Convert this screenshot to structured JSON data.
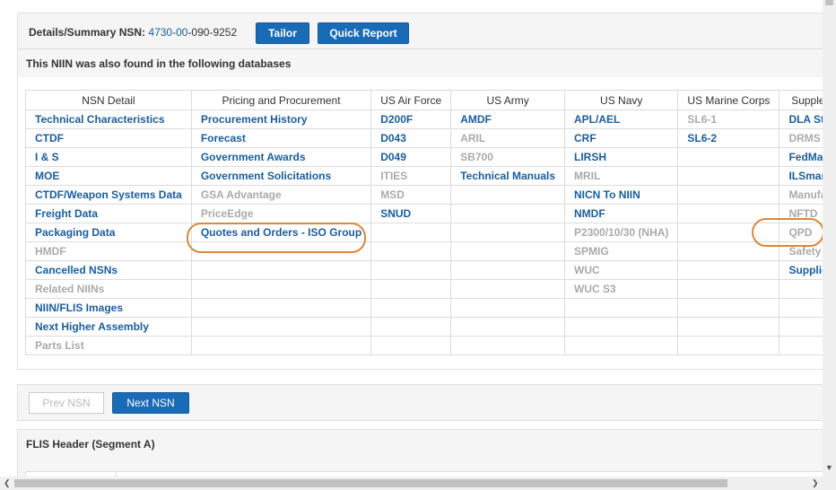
{
  "header": {
    "label": "Details/Summary NSN:",
    "nsn_link": "4730-00",
    "nsn_rest": "-090-9252",
    "tailor_label": "Tailor",
    "quick_report_label": "Quick Report"
  },
  "found_text": "This NIIN was also found in the following databases",
  "table": {
    "headers": [
      "NSN Detail",
      "Pricing and Procurement",
      "US Air Force",
      "US Army",
      "US Navy",
      "US Marine Corps",
      "Supplement"
    ],
    "rows": [
      [
        {
          "t": "Technical Characteristics",
          "s": "link"
        },
        {
          "t": "Procurement History",
          "s": "link"
        },
        {
          "t": "D200F",
          "s": "link"
        },
        {
          "t": "AMDF",
          "s": "link"
        },
        {
          "t": "APL/AEL",
          "s": "link"
        },
        {
          "t": "SL6-1",
          "s": "grey"
        },
        {
          "t": "DLA Stock",
          "s": "link"
        }
      ],
      [
        {
          "t": "CTDF",
          "s": "link"
        },
        {
          "t": "Forecast",
          "s": "link"
        },
        {
          "t": "D043",
          "s": "link"
        },
        {
          "t": "ARIL",
          "s": "grey"
        },
        {
          "t": "CRF",
          "s": "link"
        },
        {
          "t": "SL6-2",
          "s": "link"
        },
        {
          "t": "DRMS",
          "s": "grey"
        }
      ],
      [
        {
          "t": "I & S",
          "s": "link"
        },
        {
          "t": "Government Awards",
          "s": "link"
        },
        {
          "t": "D049",
          "s": "link"
        },
        {
          "t": "SB700",
          "s": "grey"
        },
        {
          "t": "LIRSH",
          "s": "link"
        },
        {
          "t": "",
          "s": ""
        },
        {
          "t": "FedMall",
          "s": "link"
        }
      ],
      [
        {
          "t": "MOE",
          "s": "link"
        },
        {
          "t": "Government Solicitations",
          "s": "link"
        },
        {
          "t": "ITIES",
          "s": "grey"
        },
        {
          "t": "Technical Manuals",
          "s": "link"
        },
        {
          "t": "MRIL",
          "s": "grey"
        },
        {
          "t": "",
          "s": ""
        },
        {
          "t": "ILSmart",
          "s": "link"
        }
      ],
      [
        {
          "t": "CTDF/Weapon Systems Data",
          "s": "link"
        },
        {
          "t": "GSA Advantage",
          "s": "grey"
        },
        {
          "t": "MSD",
          "s": "grey"
        },
        {
          "t": "",
          "s": ""
        },
        {
          "t": "NICN To NIIN",
          "s": "link"
        },
        {
          "t": "",
          "s": ""
        },
        {
          "t": "Manufactur",
          "s": "grey"
        }
      ],
      [
        {
          "t": "Freight Data",
          "s": "link"
        },
        {
          "t": "PriceEdge",
          "s": "grey"
        },
        {
          "t": "SNUD",
          "s": "link"
        },
        {
          "t": "",
          "s": ""
        },
        {
          "t": "NMDF",
          "s": "link"
        },
        {
          "t": "",
          "s": ""
        },
        {
          "t": "NFTD",
          "s": "grey"
        }
      ],
      [
        {
          "t": "Packaging Data",
          "s": "link"
        },
        {
          "t": "Quotes and Orders - ISO Group",
          "s": "link"
        },
        {
          "t": "",
          "s": ""
        },
        {
          "t": "",
          "s": ""
        },
        {
          "t": "P2300/10/30 (NHA)",
          "s": "grey"
        },
        {
          "t": "",
          "s": ""
        },
        {
          "t": "QPD",
          "s": "grey"
        }
      ],
      [
        {
          "t": "HMDF",
          "s": "grey"
        },
        {
          "t": "",
          "s": ""
        },
        {
          "t": "",
          "s": ""
        },
        {
          "t": "",
          "s": ""
        },
        {
          "t": "SPMIG",
          "s": "grey"
        },
        {
          "t": "",
          "s": ""
        },
        {
          "t": "Safety Data",
          "s": "grey"
        }
      ],
      [
        {
          "t": "Cancelled NSNs",
          "s": "link"
        },
        {
          "t": "",
          "s": ""
        },
        {
          "t": "",
          "s": ""
        },
        {
          "t": "",
          "s": ""
        },
        {
          "t": "WUC",
          "s": "grey"
        },
        {
          "t": "",
          "s": ""
        },
        {
          "t": "Supplier Inv",
          "s": "link"
        }
      ],
      [
        {
          "t": "Related NIINs",
          "s": "grey"
        },
        {
          "t": "",
          "s": ""
        },
        {
          "t": "",
          "s": ""
        },
        {
          "t": "",
          "s": ""
        },
        {
          "t": "WUC S3",
          "s": "grey"
        },
        {
          "t": "",
          "s": ""
        },
        {
          "t": "",
          "s": ""
        }
      ],
      [
        {
          "t": "NIIN/FLIS Images",
          "s": "link"
        },
        {
          "t": "",
          "s": ""
        },
        {
          "t": "",
          "s": ""
        },
        {
          "t": "",
          "s": ""
        },
        {
          "t": "",
          "s": ""
        },
        {
          "t": "",
          "s": ""
        },
        {
          "t": "",
          "s": ""
        }
      ],
      [
        {
          "t": "Next Higher Assembly",
          "s": "link"
        },
        {
          "t": "",
          "s": ""
        },
        {
          "t": "",
          "s": ""
        },
        {
          "t": "",
          "s": ""
        },
        {
          "t": "",
          "s": ""
        },
        {
          "t": "",
          "s": ""
        },
        {
          "t": "",
          "s": ""
        }
      ],
      [
        {
          "t": "Parts List",
          "s": "grey"
        },
        {
          "t": "",
          "s": ""
        },
        {
          "t": "",
          "s": ""
        },
        {
          "t": "",
          "s": ""
        },
        {
          "t": "",
          "s": ""
        },
        {
          "t": "",
          "s": ""
        },
        {
          "t": "",
          "s": ""
        }
      ]
    ]
  },
  "pager": {
    "prev_label": "Prev NSN",
    "next_label": "Next NSN"
  },
  "flis": {
    "title": "FLIS Header (Segment A)"
  },
  "colors": {
    "link": "#1a5d9c",
    "disabled": "#aaaaaa",
    "button": "#1a6bb5",
    "highlight": "#d8883f"
  }
}
